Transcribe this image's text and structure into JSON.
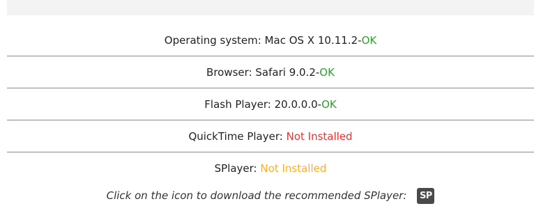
{
  "checks": [
    {
      "label": "Operating system:",
      "value": "Mac OS X 10.11.2",
      "separator": " - ",
      "status": "OK",
      "status_color": "#2f9e2f"
    },
    {
      "label": "Browser:",
      "value": "Safari 9.0.2",
      "separator": " - ",
      "status": "OK",
      "status_color": "#2f9e2f"
    },
    {
      "label": "Flash Player:",
      "value": "20.0.0.0",
      "separator": " - ",
      "status": "OK",
      "status_color": "#2f9e2f"
    },
    {
      "label": "QuickTime Player:",
      "status": "Not Installed",
      "status_color": "#ff2a2a"
    },
    {
      "label": "SPlayer:",
      "status": "Not Installed",
      "status_color": "#ffae21"
    }
  ],
  "download": {
    "text": "Click on the icon to download the recommended SPlayer:",
    "icon_text": "SP",
    "icon_name": "splayer-icon"
  }
}
